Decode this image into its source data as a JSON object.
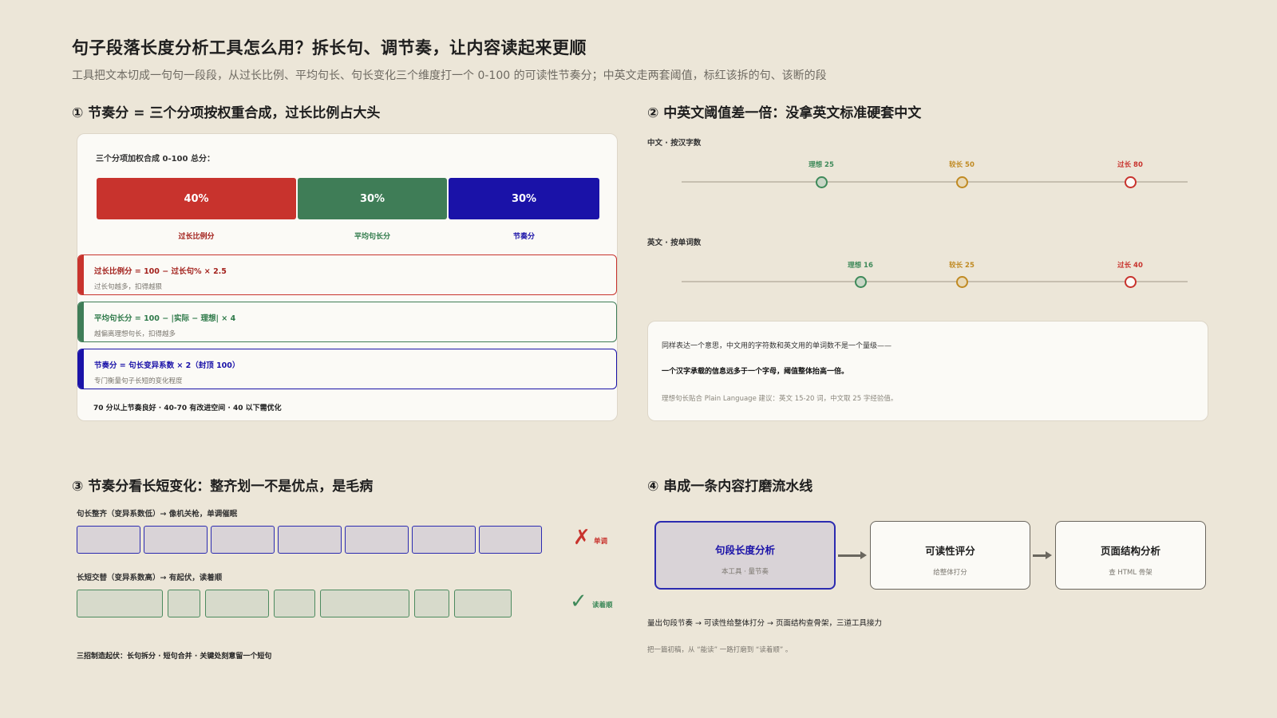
{
  "header": {
    "title": "句子段落长度分析工具怎么用？拆长句、调节奏，让内容读起来更顺",
    "subtitle": "工具把文本切成一句句一段段，从过长比例、平均句长、句长变化三个维度打一个 0-100 的可读性节奏分；中英文走两套阈值，标红该拆的句、该断的段"
  },
  "section1": {
    "heading": "① 节奏分 = 三个分项按权重合成，过长比例占大头",
    "caption": "三个分项加权合成 0-100 总分：",
    "segments": [
      {
        "pct": "40%",
        "label": "过长比例分",
        "weight": 40,
        "color": "#c8332d"
      },
      {
        "pct": "30%",
        "label": "平均句长分",
        "weight": 30,
        "color": "#3f7d57"
      },
      {
        "pct": "30%",
        "label": "节奏分",
        "weight": 30,
        "color": "#1a12a8"
      }
    ],
    "formulas": [
      {
        "main": "过长比例分 = 100 − 过长句% × 2.5",
        "sub": "过长句越多，扣得越狠",
        "color": "#c8332d",
        "textColor": "#a3221d"
      },
      {
        "main": "平均句长分 = 100 − |实际 − 理想| × 4",
        "sub": "越偏离理想句长，扣得越多",
        "color": "#3f7d57",
        "textColor": "#2f7a4a"
      },
      {
        "main": "节奏分 = 句长变异系数 × 2（封顶 100）",
        "sub": "专门衡量句子长短的变化程度",
        "color": "#1a12a8",
        "textColor": "#1a12a8"
      }
    ],
    "footer": "70 分以上节奏良好 · 40-70 有改进空间 · 40 以下需优化"
  },
  "section2": {
    "heading": "② 中英文阈值差一倍：没拿英文标准硬套中文",
    "rows": [
      {
        "label": "中文 · 按汉字数",
        "ticks": [
          {
            "label": "理想 25",
            "value": 25,
            "color": "#3f8a5a",
            "fill": "#c9d6c6"
          },
          {
            "label": "较长 50",
            "value": 50,
            "color": "#c08a22",
            "fill": "#e8d9b8"
          },
          {
            "label": "过长 80",
            "value": 80,
            "color": "#c8332d",
            "fill": "#fbfaf6"
          }
        ]
      },
      {
        "label": "英文 · 按单词数",
        "ticks": [
          {
            "label": "理想 16",
            "value": 16,
            "color": "#3f8a5a",
            "fill": "#c9d6c6"
          },
          {
            "label": "较长 25",
            "value": 25,
            "color": "#c08a22",
            "fill": "#e8d9b8"
          },
          {
            "label": "过长 40",
            "value": 40,
            "color": "#c8332d",
            "fill": "#fbfaf6"
          }
        ]
      }
    ],
    "info": {
      "line1": "同样表达一个意思，中文用的字符数和英文用的单词数不是一个量级——",
      "line2": "一个汉字承载的信息远多于一个字母，阈值整体抬高一倍。",
      "line3": "理想句长贴合 Plain Language 建议：英文 15-20 词，中文取 25 字经验值。"
    }
  },
  "section3": {
    "heading": "③ 节奏分看长短变化：整齐划一不是优点，是毛病",
    "uniform": {
      "caption": "句长整齐（变异系数低）→ 像机关枪，单调催眠",
      "mark": "✗",
      "mark_label": "单调",
      "lengths": [
        1,
        1,
        1,
        1,
        1,
        1,
        1
      ]
    },
    "varied": {
      "caption": "长短交替（变异系数高）→ 有起伏，读着顺",
      "mark": "✓",
      "mark_label": "读着顺",
      "lengths": [
        108,
        41,
        80,
        52,
        112,
        44,
        72
      ]
    },
    "footer": "三招制造起伏：长句拆分 · 短句合并 · 关键处刻意留一个短句"
  },
  "section4": {
    "heading": "④ 串成一条内容打磨流水线",
    "nodes": [
      {
        "title": "句段长度分析",
        "sub": "本工具 · 量节奏"
      },
      {
        "title": "可读性评分",
        "sub": "给整体打分"
      },
      {
        "title": "页面结构分析",
        "sub": "查 HTML 骨架"
      }
    ],
    "footer1": "量出句段节奏 → 可读性给整体打分 → 页面结构查骨架，三道工具接力",
    "footer2": "把一篇初稿，从 “能读” 一路打磨到 “读着顺” 。"
  }
}
